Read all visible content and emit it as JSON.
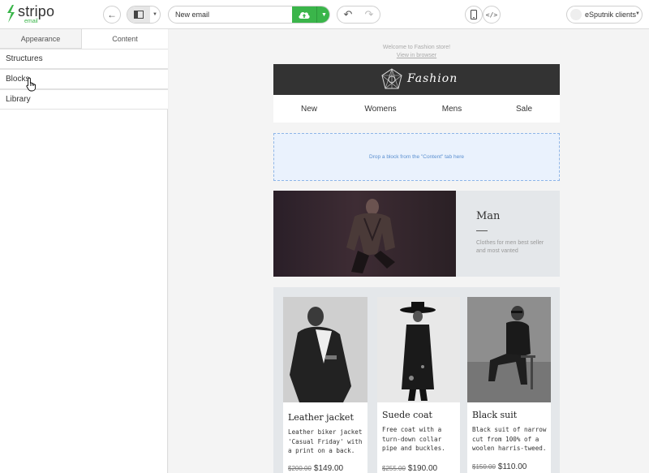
{
  "app": {
    "logo_word": "stripo",
    "logo_sub": "email"
  },
  "toolbar": {
    "email_name": "New email",
    "account": "eSputnik clients"
  },
  "leftpanel": {
    "tabs": [
      {
        "label": "Appearance"
      },
      {
        "label": "Content"
      }
    ],
    "items": [
      {
        "label": "Structures"
      },
      {
        "label": "Blocks"
      },
      {
        "label": "Library"
      }
    ]
  },
  "email": {
    "preheader": "Welcome to Fashion store!",
    "view_in_browser": "View in browser",
    "brand": "Fashion",
    "menu": [
      "New",
      "Womens",
      "Mens",
      "Sale"
    ],
    "dropzone": "Drop a block from the \"Content\" tab here",
    "hero": {
      "title": "Man",
      "desc": "Clothes for men best seller and most vanted"
    },
    "products": [
      {
        "name": "Leather jacket",
        "desc": "Leather biker jacket 'Casual Friday' with a print on a back.",
        "old_price": "$200.00",
        "price": "$149.00"
      },
      {
        "name": "Suede coat",
        "desc": "Free coat with a turn-down collar pipe and buckles.",
        "old_price": "$255.00",
        "price": "$190.00"
      },
      {
        "name": "Black suit",
        "desc": "Black suit of narrow cut from 100% of a woolen harris-tweed.",
        "old_price": "$150.00",
        "price": "$110.00"
      }
    ]
  },
  "colors": {
    "accent_green": "#3ab54a",
    "banner_dark": "#333333",
    "dropzone_blue": "#eaf2fd"
  }
}
